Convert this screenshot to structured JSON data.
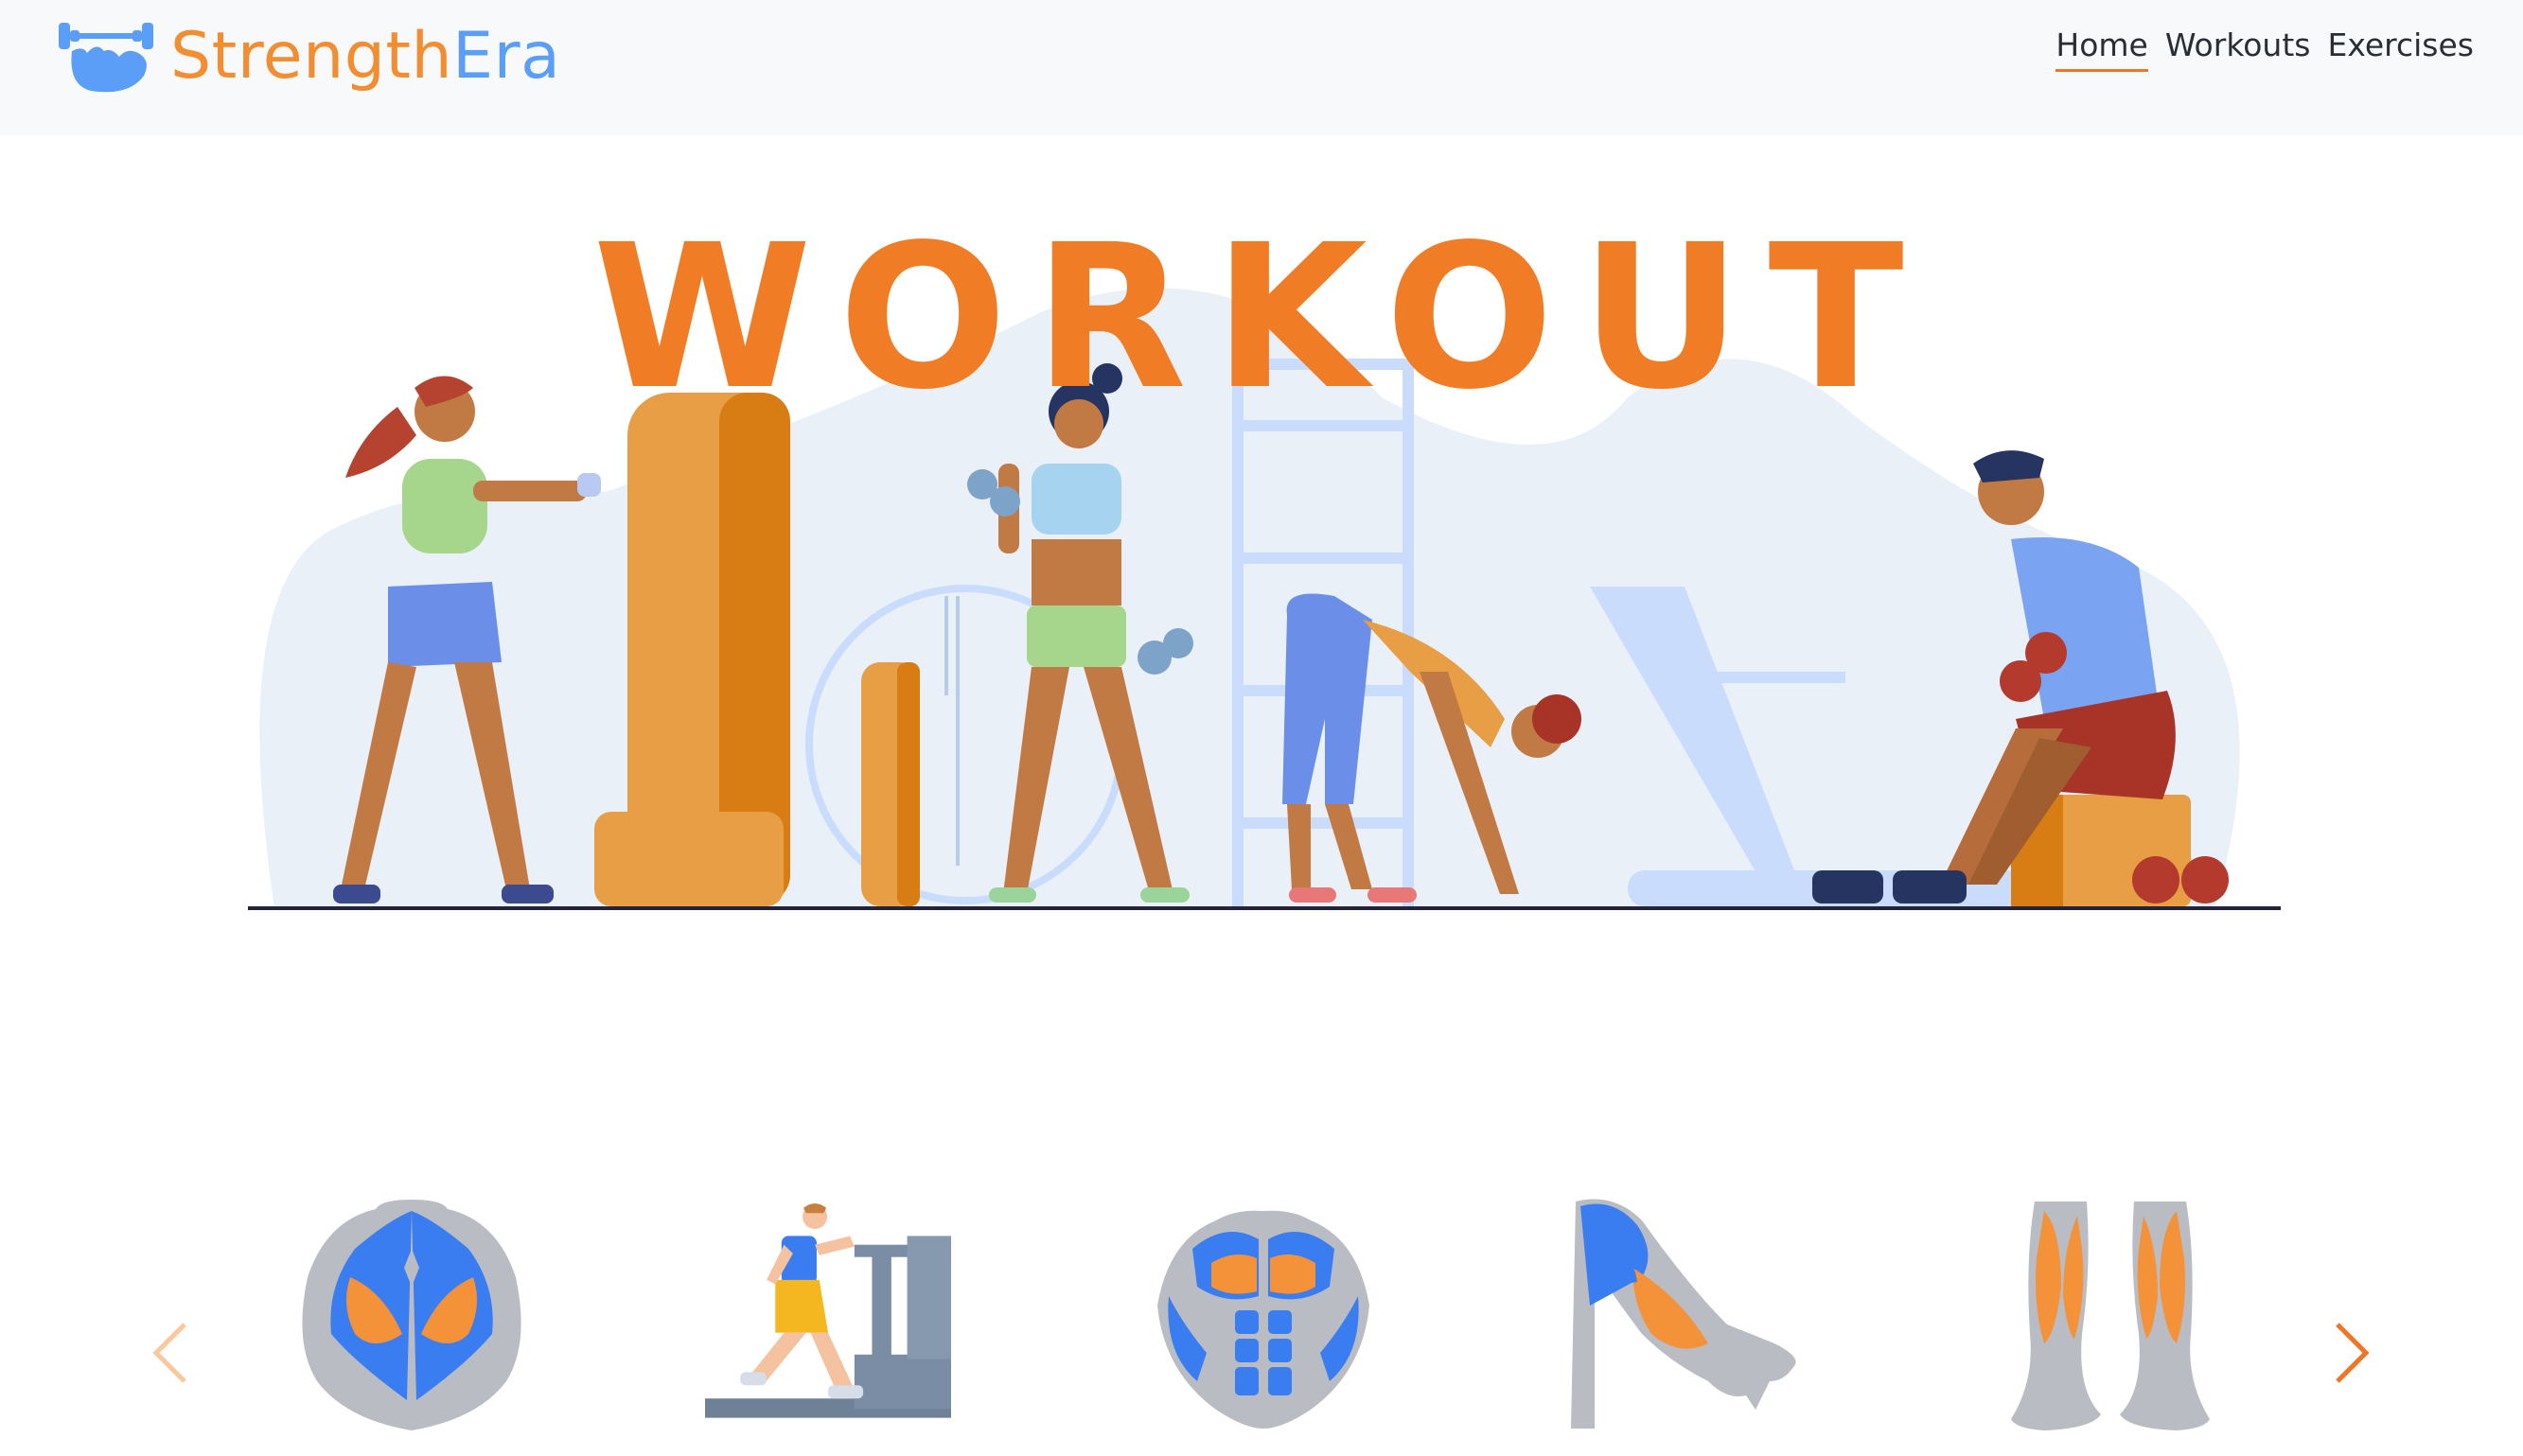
{
  "brand": {
    "part1": "Strength",
    "part2": "Era",
    "logo_icon": "flexed-arm-dumbbell-icon"
  },
  "nav": {
    "items": [
      {
        "label": "Home",
        "active": true
      },
      {
        "label": "Workouts",
        "active": false
      },
      {
        "label": "Exercises",
        "active": false
      }
    ]
  },
  "hero": {
    "title": "WORKOUT",
    "illustration": "gym-scene-illustration"
  },
  "carousel": {
    "items": [
      {
        "icon": "back-muscles-icon"
      },
      {
        "icon": "treadmill-runner-icon"
      },
      {
        "icon": "chest-muscles-icon"
      },
      {
        "icon": "arm-muscles-icon"
      },
      {
        "icon": "calf-muscles-icon"
      }
    ],
    "prev_icon": "chevron-left-icon",
    "next_icon": "chevron-right-icon"
  },
  "colors": {
    "orange": "#f07d26",
    "blue": "#5a9ef7",
    "navbar_bg": "#f8f9fa"
  }
}
